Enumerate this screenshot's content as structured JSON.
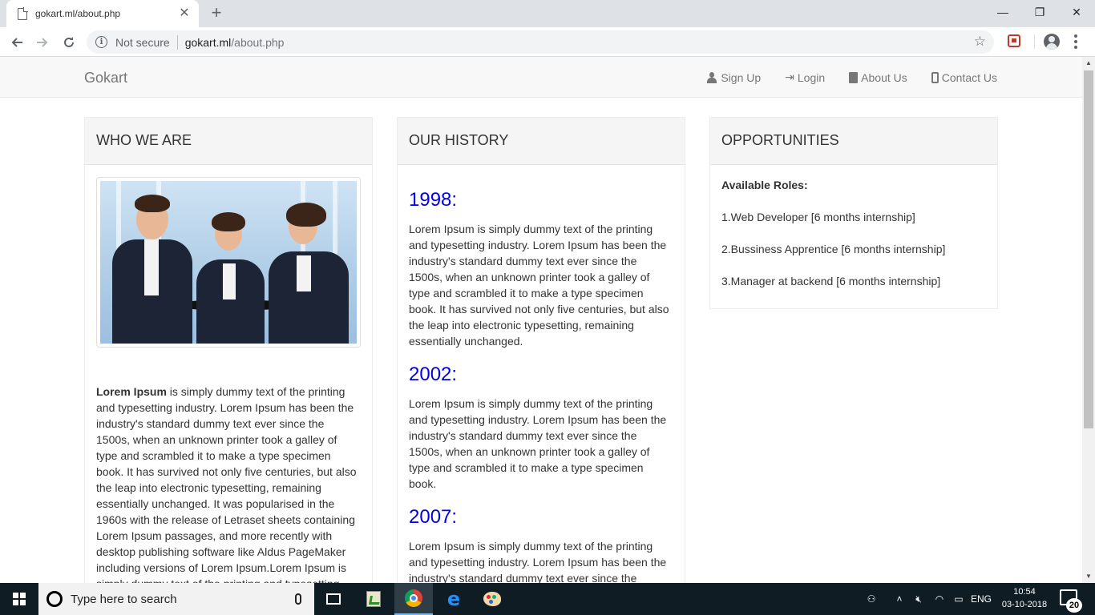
{
  "browser": {
    "tab_title": "gokart.ml/about.php",
    "tab_close": "✕",
    "new_tab": "+",
    "security_text": "Not secure",
    "url_host": "gokart.ml",
    "url_path": "/about.php",
    "window_controls": {
      "minimize": "—",
      "restore": "❐",
      "close": "✕"
    }
  },
  "site": {
    "brand": "Gokart",
    "nav": [
      {
        "label": "Sign Up",
        "icon": "user-icon"
      },
      {
        "label": "Login",
        "icon": "login-icon"
      },
      {
        "label": "About Us",
        "icon": "book-icon"
      },
      {
        "label": "Contact Us",
        "icon": "phone-icon"
      }
    ]
  },
  "who_we_are": {
    "heading": "WHO WE ARE",
    "bold_lead": "Lorem Ipsum",
    "text": " is simply dummy text of the printing and typesetting industry. Lorem Ipsum has been the industry's standard dummy text ever since the 1500s, when an unknown printer took a galley of type and scrambled it to make a type specimen book. It has survived not only five centuries, but also the leap into electronic typesetting, remaining essentially unchanged. It was popularised in the 1960s with the release of Letraset sheets containing Lorem Ipsum passages, and more recently with desktop publishing software like Aldus PageMaker including versions of Lorem Ipsum.Lorem Ipsum is simply dummy text of the printing and typesetting"
  },
  "our_history": {
    "heading": "OUR HISTORY",
    "entries": [
      {
        "year": "1998:",
        "text": "Lorem Ipsum is simply dummy text of the printing and typesetting industry. Lorem Ipsum has been the industry's standard dummy text ever since the 1500s, when an unknown printer took a galley of type and scrambled it to make a type specimen book. It has survived not only five centuries, but also the leap into electronic typesetting, remaining essentially unchanged."
      },
      {
        "year": "2002:",
        "text": "Lorem Ipsum is simply dummy text of the printing and typesetting industry. Lorem Ipsum has been the industry's standard dummy text ever since the 1500s, when an unknown printer took a galley of type and scrambled it to make a type specimen book."
      },
      {
        "year": "2007:",
        "text": "Lorem Ipsum is simply dummy text of the printing and typesetting industry. Lorem Ipsum has been the industry's standard dummy text ever since the"
      }
    ]
  },
  "opportunities": {
    "heading": "OPPORTUNITIES",
    "roles_title": "Available Roles:",
    "roles": [
      "1.Web Developer [6 months internship]",
      "2.Bussiness Apprentice [6 months internship]",
      "3.Manager at backend [6 months internship]"
    ]
  },
  "taskbar": {
    "search_placeholder": "Type here to search",
    "language": "ENG",
    "time": "10:54",
    "date": "03-10-2018",
    "notification_count": "20"
  }
}
